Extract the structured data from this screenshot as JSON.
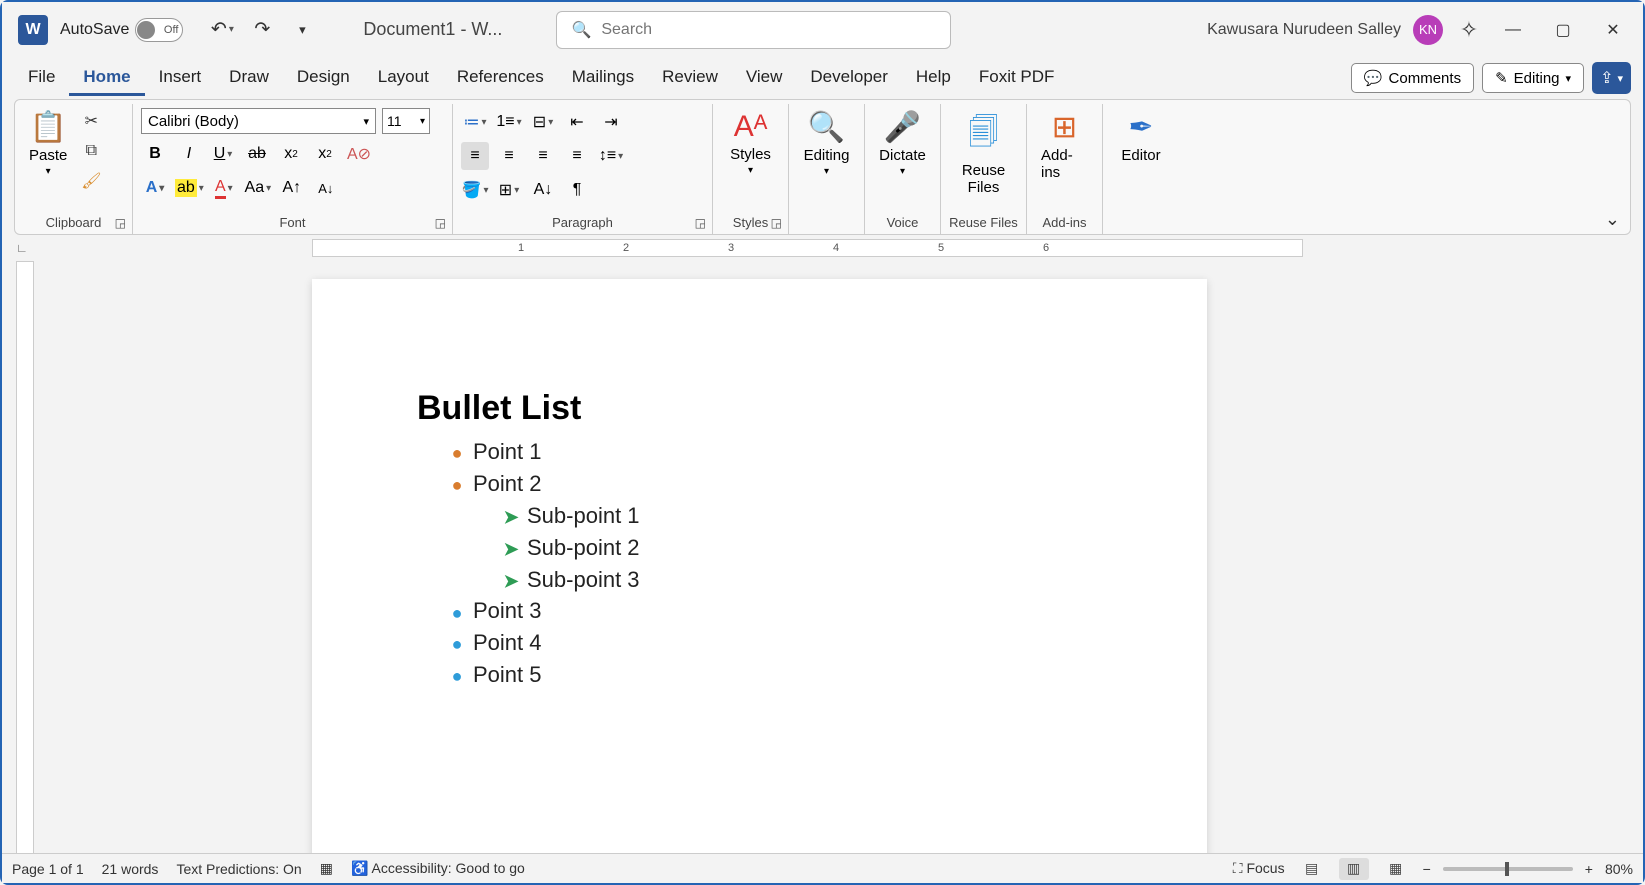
{
  "titlebar": {
    "autosave_label": "AutoSave",
    "autosave_state": "Off",
    "doc_title": "Document1  -  W...",
    "search_placeholder": "Search",
    "user_name": "Kawusara Nurudeen Salley",
    "user_initials": "KN"
  },
  "menu": {
    "items": [
      "File",
      "Home",
      "Insert",
      "Draw",
      "Design",
      "Layout",
      "References",
      "Mailings",
      "Review",
      "View",
      "Developer",
      "Help",
      "Foxit PDF"
    ],
    "active_index": 1,
    "comments_label": "Comments",
    "editing_label": "Editing"
  },
  "ribbon": {
    "clipboard": {
      "paste": "Paste",
      "label": "Clipboard"
    },
    "font": {
      "name": "Calibri (Body)",
      "size": "11",
      "label": "Font"
    },
    "paragraph": {
      "label": "Paragraph"
    },
    "styles": {
      "btn": "Styles",
      "label": "Styles"
    },
    "editing": {
      "btn": "Editing"
    },
    "voice": {
      "btn": "Dictate",
      "label": "Voice"
    },
    "reuse": {
      "btn": "Reuse Files",
      "label": "Reuse Files"
    },
    "addins": {
      "btn": "Add-ins",
      "label": "Add-ins"
    },
    "editor": {
      "btn": "Editor"
    }
  },
  "ruler": {
    "nums": [
      "1",
      "2",
      "3",
      "4",
      "5",
      "6"
    ]
  },
  "document": {
    "title": "Bullet List",
    "lines": [
      {
        "level": 0,
        "bullet_color": "orange",
        "text": "Point 1"
      },
      {
        "level": 0,
        "bullet_color": "orange",
        "text": "Point 2"
      },
      {
        "level": 1,
        "bullet_color": "green",
        "text": "Sub-point 1"
      },
      {
        "level": 1,
        "bullet_color": "green",
        "text": "Sub-point 2"
      },
      {
        "level": 1,
        "bullet_color": "green",
        "text": "Sub-point 3"
      },
      {
        "level": 0,
        "bullet_color": "blue",
        "text": "Point 3"
      },
      {
        "level": 0,
        "bullet_color": "blue",
        "text": "Point 4"
      },
      {
        "level": 0,
        "bullet_color": "blue",
        "text": "Point 5"
      }
    ]
  },
  "status": {
    "page": "Page 1 of 1",
    "words": "21 words",
    "predictions": "Text Predictions: On",
    "accessibility": "Accessibility: Good to go",
    "focus": "Focus",
    "zoom": "80%"
  }
}
